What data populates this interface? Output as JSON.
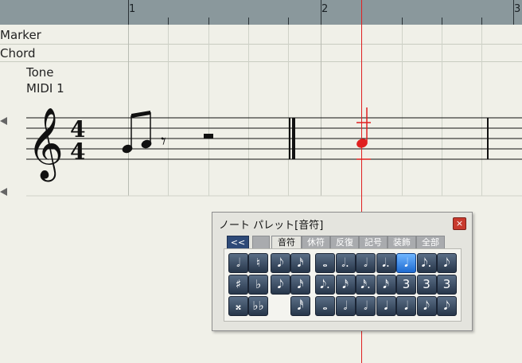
{
  "ruler": {
    "labels": [
      "1",
      "2",
      "3"
    ]
  },
  "rows": {
    "marker": "Marker",
    "chord": "Chord"
  },
  "track": {
    "name": "Tone",
    "channel": "MIDI 1"
  },
  "score": {
    "time_signature_top": "4",
    "time_signature_bottom": "4"
  },
  "palette": {
    "title": "ノート パレット[音符]",
    "close_glyph": "×",
    "back_glyph": "<<",
    "tabs": [
      "音符",
      "休符",
      "反復",
      "記号",
      "装飾",
      "全部"
    ],
    "active_tab": "音符",
    "left_buttons": [
      "𝅗𝅥",
      "♮",
      "♯",
      "♭",
      "𝄪",
      "♭♭"
    ],
    "mid_buttons": [
      "𝅘𝅥𝅮",
      "𝅘𝅥𝅯",
      "𝅘𝅥𝅮",
      "𝅘𝅥𝅯",
      "𝅘𝅥𝅰"
    ],
    "note_buttons": [
      "𝅝",
      "𝅗𝅥.",
      "𝅗𝅥",
      "𝅘𝅥.",
      "𝅘𝅥",
      "𝅘𝅥𝅮.",
      "𝅘𝅥𝅮",
      "𝅘𝅥𝅮.",
      "𝅘𝅥𝅯",
      "𝅘𝅥𝅯.",
      "𝅘𝅥𝅯",
      "3",
      "3",
      "3",
      "𝅝",
      "𝅗𝅥",
      "𝅗𝅥",
      "𝅘𝅥",
      "𝅘𝅥",
      "𝅘𝅥𝅮",
      "𝅘𝅥𝅮"
    ],
    "selected_note_index": 4
  },
  "colors": {
    "cursor": "#e02020",
    "selected": "#1e6ad0",
    "ruler": "#8a989c"
  }
}
